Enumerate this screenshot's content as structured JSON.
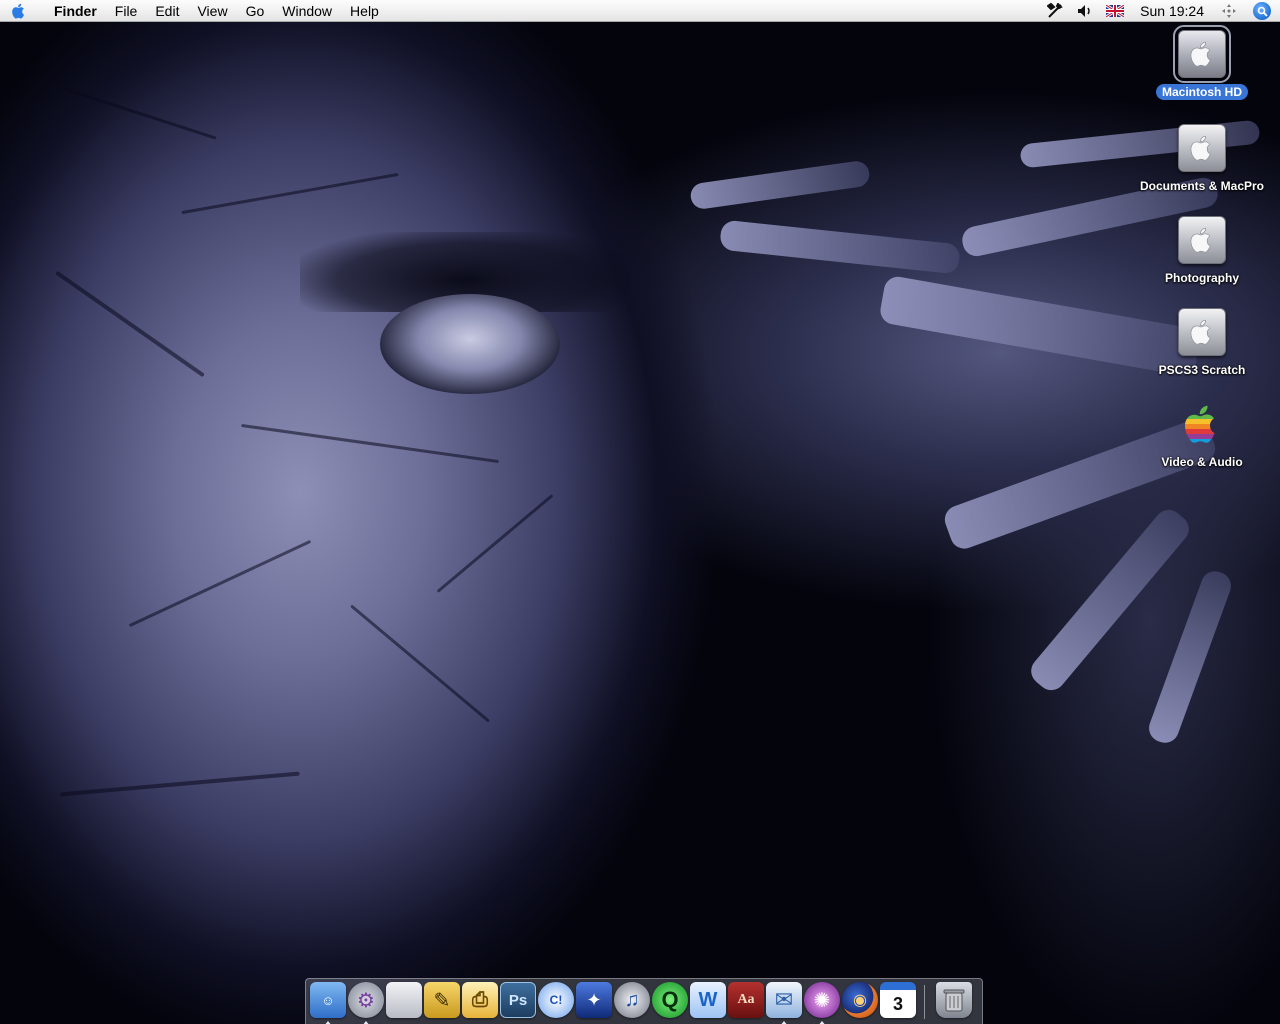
{
  "menubar": {
    "apple_icon": "apple-logo-icon",
    "app_name": "Finder",
    "items": [
      "File",
      "Edit",
      "View",
      "Go",
      "Window",
      "Help"
    ],
    "status_icons": [
      "tools-icon",
      "volume-icon",
      "uk-flag-icon"
    ],
    "clock": "Sun 19:24",
    "extra_icons": [
      "move-arrows-icon",
      "spotlight-search-icon"
    ]
  },
  "desktop": {
    "icons": [
      {
        "label": "Macintosh HD",
        "icon": "hard-drive-icon",
        "selected": true
      },
      {
        "label": "Documents & MacPro",
        "icon": "hard-drive-icon",
        "selected": false
      },
      {
        "label": "Photography",
        "icon": "hard-drive-icon",
        "selected": false
      },
      {
        "label": "PSCS3 Scratch",
        "icon": "hard-drive-icon",
        "selected": false
      },
      {
        "label": "Video & Audio",
        "icon": "rainbow-apple-icon",
        "selected": false
      }
    ]
  },
  "dock": {
    "items": [
      {
        "name": "finder",
        "icon": "finder-icon",
        "glyph": "☺",
        "color": "#4a8fe0",
        "running": true
      },
      {
        "name": "system-preferences",
        "icon": "gear-prefs-icon",
        "glyph": "⚙",
        "color": "#8a8f9c",
        "running": true
      },
      {
        "name": "boot-camp",
        "icon": "apple-window-icon",
        "glyph": "",
        "color": "#c9ccd4",
        "running": false
      },
      {
        "name": "pencil-app",
        "icon": "pencil-icon",
        "glyph": "✎",
        "color": "#e3b33a",
        "running": false
      },
      {
        "name": "printer-app",
        "icon": "printer-icon",
        "glyph": "⎙",
        "color": "#f0c040",
        "running": false
      },
      {
        "name": "photoshop",
        "icon": "photoshop-icon",
        "glyph": "Ps",
        "color": "#2c5d8f",
        "running": false
      },
      {
        "name": "comic-life",
        "icon": "comic-life-icon",
        "glyph": "C!",
        "color": "#3a6fd8",
        "running": false
      },
      {
        "name": "wizard-app",
        "icon": "wizard-icon",
        "glyph": "✦",
        "color": "#1d3f9a",
        "running": false
      },
      {
        "name": "itunes",
        "icon": "itunes-icon",
        "glyph": "♫",
        "color": "#6f7480",
        "running": false
      },
      {
        "name": "quicktime",
        "icon": "quicktime-icon",
        "glyph": "Q",
        "color": "#1a9c2a",
        "running": false
      },
      {
        "name": "web-app",
        "icon": "web-w-icon",
        "glyph": "W",
        "color": "#1e6fd0",
        "running": false
      },
      {
        "name": "dictionary",
        "icon": "dictionary-icon",
        "glyph": "Aa",
        "color": "#8b1a1a",
        "running": false
      },
      {
        "name": "mail",
        "icon": "mail-icon",
        "glyph": "✉",
        "color": "#5f8fcf",
        "running": true
      },
      {
        "name": "ical-app",
        "icon": "nebula-icon",
        "glyph": "✺",
        "color": "#b04fc0",
        "running": true
      },
      {
        "name": "firefox",
        "icon": "firefox-icon",
        "glyph": "◉",
        "color": "#e0782a",
        "running": false
      },
      {
        "name": "ical",
        "icon": "calendar-icon",
        "glyph": "3",
        "color": "#ffffff",
        "running": false
      },
      {
        "name": "trash",
        "icon": "trash-icon",
        "glyph": "🗑",
        "color": "#8e939e",
        "running": false
      }
    ]
  }
}
